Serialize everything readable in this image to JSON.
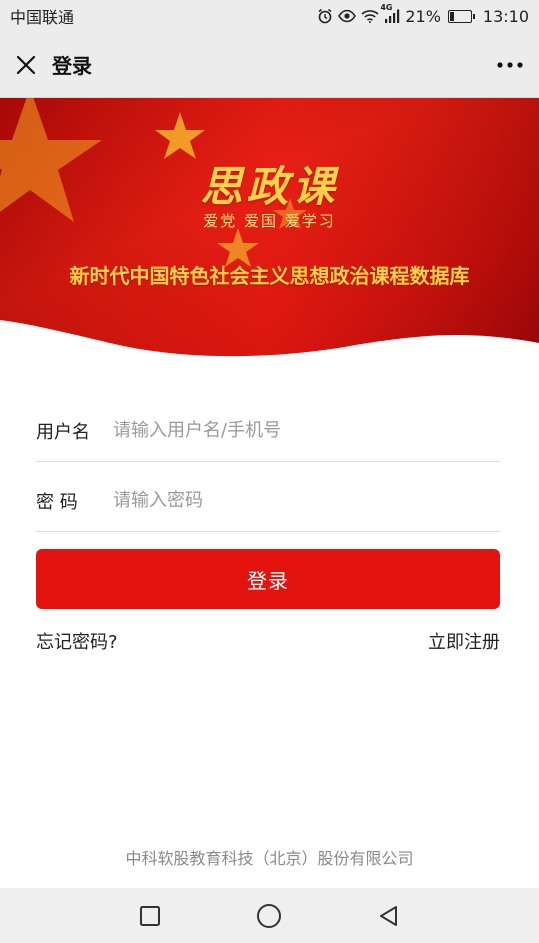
{
  "status_bar": {
    "carrier": "中国联通",
    "network": "4G",
    "battery_percent": "21%",
    "battery_level": 0.21,
    "time": "13:10",
    "icons": [
      "alarm-icon",
      "eye-icon",
      "wifi-icon",
      "signal-icon",
      "battery-icon"
    ]
  },
  "nav": {
    "title": "登录",
    "close_icon": "close-icon",
    "more_icon": "more-icon"
  },
  "banner": {
    "logo_text": "思政课",
    "slogan": "爱党 爱国 爱学习",
    "subtitle": "新时代中国特色社会主义思想政治课程数据库",
    "colors": {
      "red": "#d90f0b",
      "gold": "#ffd24a"
    }
  },
  "form": {
    "username_label": "用户名",
    "username_placeholder": "请输入用户名/手机号",
    "username_value": "",
    "password_label": "密 码",
    "password_placeholder": "请输入密码",
    "password_value": "",
    "login_button": "登录",
    "forgot_link": "忘记密码?",
    "register_link": "立即注册"
  },
  "footer": {
    "company": "中科软股教育科技（北京）股份有限公司"
  },
  "system_nav": {
    "icons": [
      "recent-apps-icon",
      "home-icon",
      "back-icon"
    ]
  },
  "theme": {
    "accent": "#e3130f"
  }
}
